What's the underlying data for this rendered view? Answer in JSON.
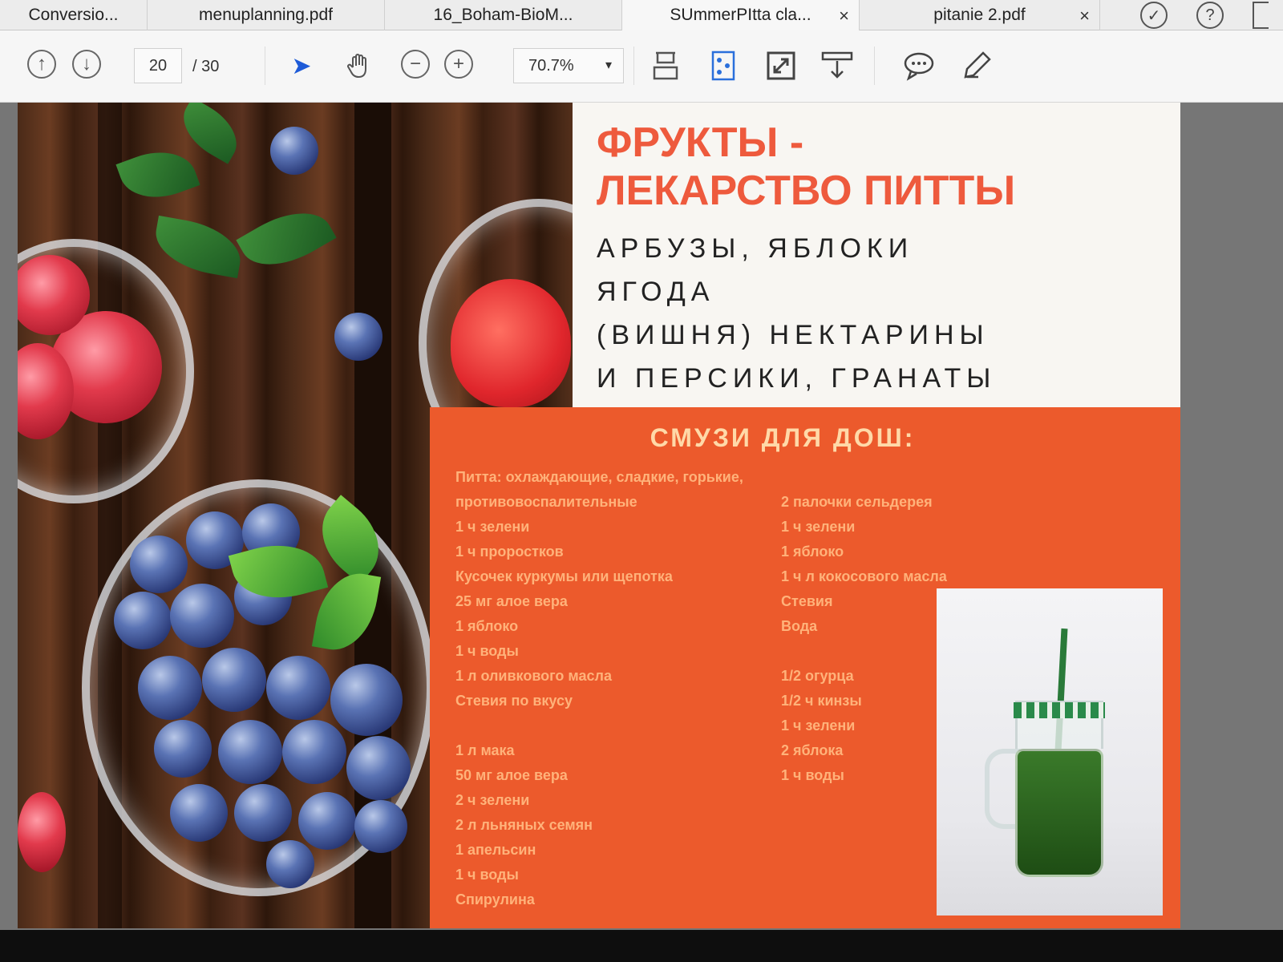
{
  "tabs": [
    {
      "label": "Conversio...",
      "closable": false
    },
    {
      "label": "menuplanning.pdf",
      "closable": false
    },
    {
      "label": "16_Boham-BioM...",
      "closable": false
    },
    {
      "label": "SUmmerPItta cla...",
      "closable": true
    },
    {
      "label": "pitanie 2.pdf",
      "closable": true
    }
  ],
  "toolbar": {
    "current_page": "20",
    "page_total": "/ 30",
    "zoom": "70.7%"
  },
  "icons": [
    "prev-page-icon",
    "next-page-icon",
    "select-arrow-icon",
    "hand-icon",
    "zoom-out-icon",
    "zoom-in-icon",
    "scroll-mode-icon",
    "page-display-icon",
    "full-screen-icon",
    "read-mode-icon",
    "comment-icon",
    "highlight-pen-icon",
    "checkmark-icon",
    "help-icon"
  ],
  "document": {
    "title": "ФРУКТЫ -\nЛЕКАРСТВО ПИТТЫ",
    "subtitle": "АРБУЗЫ, ЯБЛОКИ\nЯГОДА\n(ВИШНЯ) НЕКТАРИНЫ\nИ ПЕРСИКИ, ГРАНАТЫ",
    "smoothie_title": "СМУЗИ ДЛЯ ДОШ:",
    "left_column": [
      "Питта: охлаждающие, сладкие, горькие,",
      "противовоспалительные",
      "1 ч зелени",
      "1 ч проростков",
      "Кусочек куркумы или щепотка",
      "25 мг алое вера",
      "1 яблоко",
      "1 ч воды",
      "1 л оливкового масла",
      "Стевия по вкусу",
      "",
      "1 л мака",
      "50 мг алое вера",
      "2 ч зелени",
      "2 л льняных семян",
      "1 апельсин",
      "1 ч воды",
      "Спирулина"
    ],
    "right_column": [
      "",
      "2 палочки сельдерея",
      "1 ч зелени",
      "1 яблоко",
      "1 ч л кокосового масла",
      "Стевия",
      "Вода",
      "",
      "1/2 огурца",
      "1/2 ч кинзы",
      "1 ч зелени",
      "2 яблока",
      "1 ч воды"
    ]
  },
  "colors": {
    "title": "#ee5a3d",
    "orange_block": "#ec5a2c",
    "smoothie_text": "#ffb27a"
  }
}
